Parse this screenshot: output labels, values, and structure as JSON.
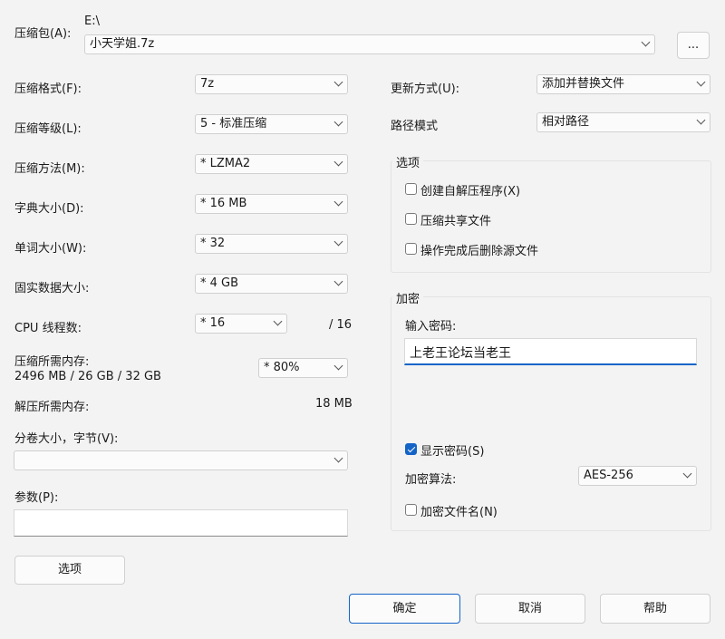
{
  "archive": {
    "label": "压缩包(A):",
    "path": "E:\\",
    "filename": "小天学姐.7z",
    "browse_label": "..."
  },
  "left": {
    "format": {
      "label": "压缩格式(F):",
      "value": "7z"
    },
    "level": {
      "label": "压缩等级(L):",
      "value": "5 - 标准压缩"
    },
    "method": {
      "label": "压缩方法(M):",
      "value": "*  LZMA2"
    },
    "dict": {
      "label": "字典大小(D):",
      "value": "*  16 MB"
    },
    "word": {
      "label": "单词大小(W):",
      "value": "*  32"
    },
    "solid": {
      "label": "固实数据大小:",
      "value": "*  4 GB"
    },
    "threads": {
      "label": "CPU 线程数:",
      "value": "*  16",
      "total": "/ 16"
    },
    "mem_compress": {
      "label": "压缩所需内存:",
      "value": "2496 MB / 26 GB / 32 GB",
      "percent": "*  80%"
    },
    "mem_decompress": {
      "label": "解压所需内存:",
      "value": "18 MB"
    },
    "volume": {
      "label": "分卷大小，字节(V):",
      "value": ""
    },
    "params": {
      "label": "参数(P):",
      "value": ""
    },
    "options_button": "选项"
  },
  "right": {
    "update": {
      "label": "更新方式(U):",
      "value": "添加并替换文件"
    },
    "path_mode": {
      "label": "路径模式",
      "value": "相对路径"
    },
    "options_group": {
      "title": "选项",
      "items": [
        {
          "label": "创建自解压程序(X)",
          "checked": false
        },
        {
          "label": "压缩共享文件",
          "checked": false
        },
        {
          "label": "操作完成后删除源文件",
          "checked": false
        }
      ]
    },
    "encryption": {
      "title": "加密",
      "password_label": "输入密码:",
      "password_value": "上老王论坛当老王",
      "show_password": {
        "label": "显示密码(S)",
        "checked": true
      },
      "method_label": "加密算法:",
      "method_value": "AES-256",
      "encrypt_names": {
        "label": "加密文件名(N)",
        "checked": false
      }
    }
  },
  "footer": {
    "ok": "确定",
    "cancel": "取消",
    "help": "帮助"
  }
}
